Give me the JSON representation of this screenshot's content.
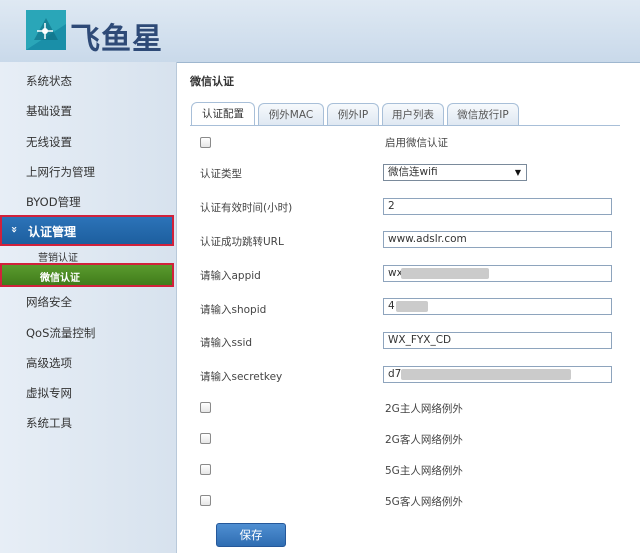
{
  "brand": {
    "name": "飞鱼星"
  },
  "sidebar": {
    "items": [
      {
        "label": "系统状态"
      },
      {
        "label": "基础设置"
      },
      {
        "label": "无线设置"
      },
      {
        "label": "上网行为管理"
      },
      {
        "label": "BYOD管理"
      },
      {
        "label": "认证管理"
      },
      {
        "label": "网络安全"
      },
      {
        "label": "QoS流量控制"
      },
      {
        "label": "高级选项"
      },
      {
        "label": "虚拟专网"
      },
      {
        "label": "系统工具"
      }
    ],
    "active_arrow": "»",
    "subitems": [
      {
        "label": "营销认证"
      },
      {
        "label": "微信认证"
      }
    ]
  },
  "main": {
    "title": "微信认证",
    "tabs": [
      {
        "label": "认证配置"
      },
      {
        "label": "例外MAC"
      },
      {
        "label": "例外IP"
      },
      {
        "label": "用户列表"
      },
      {
        "label": "微信放行IP"
      }
    ],
    "form": {
      "enable_label": "启用微信认证",
      "auth_type_label": "认证类型",
      "auth_type_value": "微信连wifi",
      "valid_time_label": "认证有效时间(小时)",
      "valid_time_value": "2",
      "redirect_label": "认证成功跳转URL",
      "redirect_value": "www.adslr.com",
      "appid_label": "请输入appid",
      "appid_value": "wx",
      "shopid_label": "请输入shopid",
      "shopid_value": "4",
      "ssid_label": "请输入ssid",
      "ssid_value": "WX_FYX_CD",
      "secretkey_label": "请输入secretkey",
      "secretkey_value": "d7",
      "exceptions": [
        {
          "label": "2G主人网络例外"
        },
        {
          "label": "2G客人网络例外"
        },
        {
          "label": "5G主人网络例外"
        },
        {
          "label": "5G客人网络例外"
        }
      ],
      "save_label": "保存"
    }
  },
  "colors": {
    "active_nav": "#1d5f9f",
    "active_sub": "#417c1b",
    "highlight_border": "#d1213b"
  }
}
